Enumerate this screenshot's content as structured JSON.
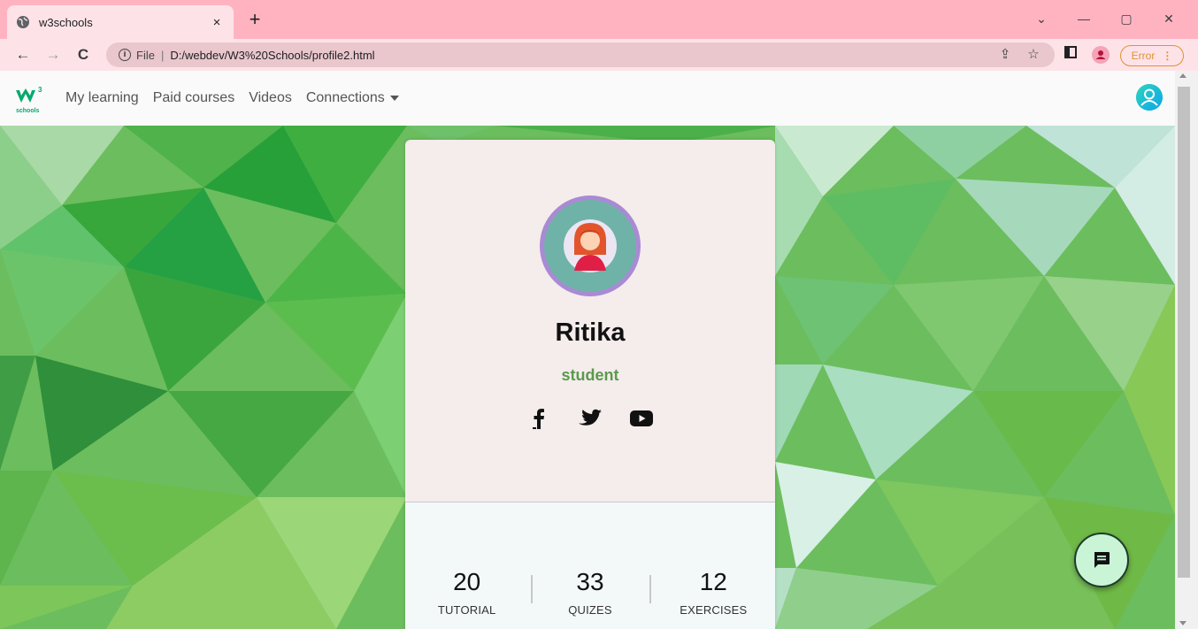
{
  "browser": {
    "tab_title": "w3schools",
    "tab_close": "×",
    "new_tab": "+",
    "address_scheme": "File",
    "address_url": "D:/webdev/W3%20Schools/profile2.html",
    "error_label": "Error",
    "window_minimize": "—",
    "window_restore": "▢",
    "window_close": "✕",
    "tab_dropdown": "⌄"
  },
  "site": {
    "logo_text": "schools",
    "nav_links": [
      "My learning",
      "Paid courses",
      "Videos",
      "Connections"
    ]
  },
  "profile": {
    "name": "Ritika",
    "role": "student",
    "socials": [
      "facebook-icon",
      "twitter-icon",
      "youtube-icon"
    ],
    "stats": [
      {
        "value": "20",
        "label": "TUTORIAL"
      },
      {
        "value": "33",
        "label": "QUIZES"
      },
      {
        "value": "12",
        "label": "EXERCISES"
      }
    ]
  },
  "colors": {
    "titlebar": "#ffb3c1",
    "toolbar": "#fde3e8",
    "role_text": "#5b9a4b",
    "card_top": "#f5ecec",
    "card_bottom": "#f3f9f8",
    "chat_fab": "#c9f5d6",
    "user_icon": "#14b8a6"
  }
}
